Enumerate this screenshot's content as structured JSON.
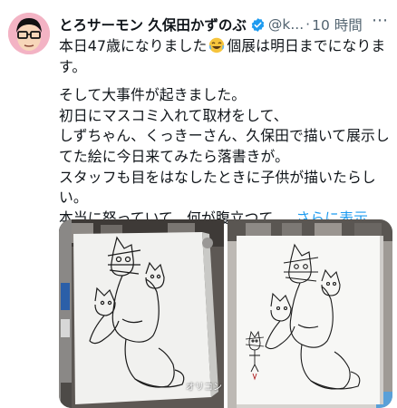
{
  "tweet": {
    "display_name": "とろサーモン 久保田かずのぶ",
    "handle": "@k...",
    "separator": "·",
    "time": "10 時間",
    "more_icon": "⋯",
    "line1_before": "本日47歳になりました",
    "line1_after": "個展は明日までになりま",
    "line2": "す。",
    "line3": "そして大事件が起きました。",
    "line4": "初日にマスコミ入れて取材をして、",
    "line5": "しずちゃん、くっきーさん、久保田で描いて展示し",
    "line6": "てた絵に今日来てみたら落書きが。",
    "line7": "スタッフも目をはなしたときに子供が描いたらし",
    "line8": "い。",
    "line9": "本当に怒っていて、何が腹立つて、",
    "show_more": "さらに表示"
  },
  "media": {
    "watermark": "オリコン"
  },
  "colors": {
    "accent": "#1d9bf0",
    "avatar_bg": "#f3b3c4"
  },
  "icons": [
    "avatar",
    "verified-badge-icon",
    "laughing-emoji-icon",
    "more-icon"
  ]
}
